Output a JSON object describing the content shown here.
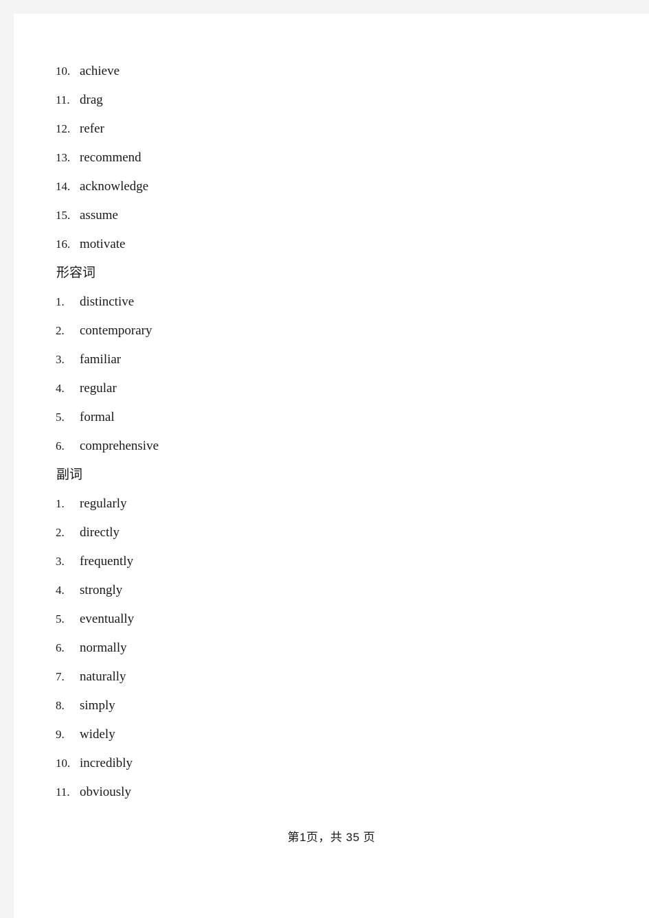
{
  "document": {
    "footer_text": "第1页，共 35 页",
    "text_color": "#1a1a1a",
    "page_background": "#ffffff",
    "gutter_color": "#f4f4f4"
  },
  "content_blocks": [
    {
      "type": "list_item",
      "number": "10.",
      "word": "achieve"
    },
    {
      "type": "list_item",
      "number": "11.",
      "word": "drag"
    },
    {
      "type": "list_item",
      "number": "12.",
      "word": "refer"
    },
    {
      "type": "list_item",
      "number": "13.",
      "word": "recommend"
    },
    {
      "type": "list_item",
      "number": "14.",
      "word": "acknowledge"
    },
    {
      "type": "list_item",
      "number": "15.",
      "word": "assume"
    },
    {
      "type": "list_item",
      "number": "16.",
      "word": "motivate"
    },
    {
      "type": "heading",
      "label": "形容词"
    },
    {
      "type": "list_item",
      "number": "1.",
      "word": "distinctive"
    },
    {
      "type": "list_item",
      "number": "2.",
      "word": "contemporary"
    },
    {
      "type": "list_item",
      "number": "3.",
      "word": "familiar"
    },
    {
      "type": "list_item",
      "number": "4.",
      "word": "regular"
    },
    {
      "type": "list_item",
      "number": "5.",
      "word": "formal"
    },
    {
      "type": "list_item",
      "number": "6.",
      "word": "comprehensive"
    },
    {
      "type": "heading",
      "label": "副词"
    },
    {
      "type": "list_item",
      "number": "1.",
      "word": "regularly"
    },
    {
      "type": "list_item",
      "number": "2.",
      "word": "directly"
    },
    {
      "type": "list_item",
      "number": "3.",
      "word": "frequently"
    },
    {
      "type": "list_item",
      "number": "4.",
      "word": "strongly"
    },
    {
      "type": "list_item",
      "number": "5.",
      "word": "eventually"
    },
    {
      "type": "list_item",
      "number": "6.",
      "word": "normally"
    },
    {
      "type": "list_item",
      "number": "7.",
      "word": "naturally"
    },
    {
      "type": "list_item",
      "number": "8.",
      "word": "simply"
    },
    {
      "type": "list_item",
      "number": "9.",
      "word": "widely"
    },
    {
      "type": "list_item",
      "number": "10.",
      "word": "incredibly"
    },
    {
      "type": "list_item",
      "number": "11.",
      "word": "obviously"
    }
  ]
}
